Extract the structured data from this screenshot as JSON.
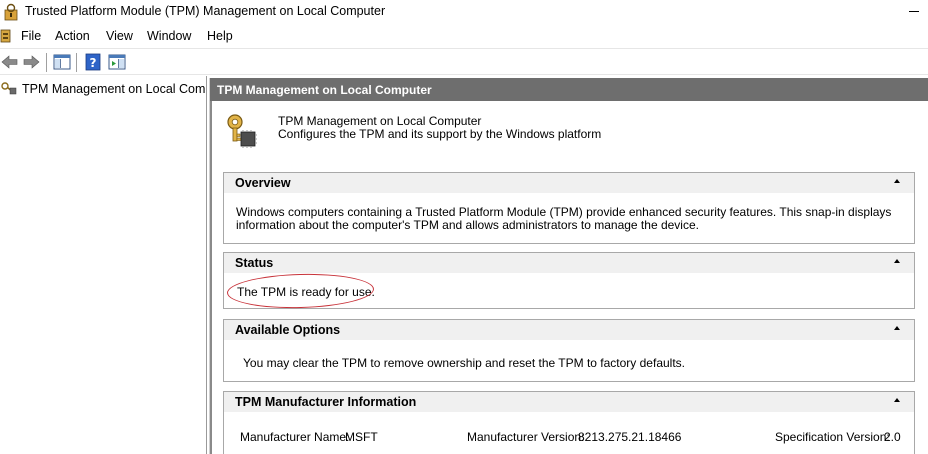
{
  "window": {
    "title": "Trusted Platform Module (TPM) Management on Local Computer"
  },
  "menu": {
    "items": [
      "File",
      "Action",
      "View",
      "Window",
      "Help"
    ]
  },
  "tree": {
    "root_label": "TPM Management on Local Comp"
  },
  "content": {
    "header": "TPM Management on Local Computer",
    "intro": {
      "title": "TPM Management on Local Computer",
      "subtitle": "Configures the TPM and its support by the Windows platform"
    },
    "overview": {
      "title": "Overview",
      "text": "Windows computers containing a Trusted Platform Module (TPM) provide enhanced security features. This snap-in displays information about the computer's TPM and allows administrators to manage the device."
    },
    "status": {
      "title": "Status",
      "text": "The TPM is ready for use."
    },
    "options": {
      "title": "Available Options",
      "text": "You may clear the TPM to remove ownership and reset the TPM to factory defaults."
    },
    "manufacturer": {
      "title": "TPM Manufacturer Information",
      "name_label": "Manufacturer Name:",
      "name_value": "MSFT",
      "version_label": "Manufacturer Version:",
      "version_value": "8213.275.21.18466",
      "spec_label": "Specification Version:",
      "spec_value": "2.0"
    }
  },
  "colors": {
    "header_bg": "#6e6e6e",
    "highlight_oval": "#c8333a"
  }
}
